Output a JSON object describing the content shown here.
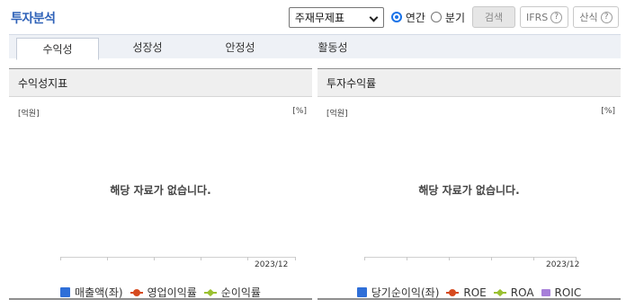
{
  "header": {
    "title": "투자분석",
    "select_value": "주재무제표",
    "radio_annual": "연간",
    "radio_quarter": "분기",
    "search_button": "검색",
    "ifrs_button": "IFRS",
    "calc_button": "산식",
    "help_glyph": "?"
  },
  "tabs": [
    {
      "label": "수익성"
    },
    {
      "label": "성장성"
    },
    {
      "label": "안정성"
    },
    {
      "label": "활동성"
    }
  ],
  "panels": {
    "left": {
      "title": "수익성지표",
      "unit_left": "[억원]",
      "unit_right": "[%]",
      "empty_message": "해당 자료가 없습니다.",
      "x_tick_label": "2023/12",
      "legend": [
        {
          "label": "매출액(좌)",
          "color": "#2f6fd8",
          "marker": "square"
        },
        {
          "label": "영업이익률",
          "color": "#d64a1f",
          "marker": "circle-line"
        },
        {
          "label": "순이익률",
          "color": "#9ac030",
          "marker": "diamond-line"
        }
      ]
    },
    "right": {
      "title": "투자수익률",
      "unit_left": "[억원]",
      "unit_right": "[%]",
      "empty_message": "해당 자료가 없습니다.",
      "x_tick_label": "2023/12",
      "legend": [
        {
          "label": "당기순이익(좌)",
          "color": "#2f6fd8",
          "marker": "square"
        },
        {
          "label": "ROE",
          "color": "#d64a1f",
          "marker": "circle-line"
        },
        {
          "label": "ROA",
          "color": "#9ac030",
          "marker": "diamond-line"
        },
        {
          "label": "ROIC",
          "color": "#a77fd9",
          "marker": "square-line"
        }
      ]
    }
  }
}
